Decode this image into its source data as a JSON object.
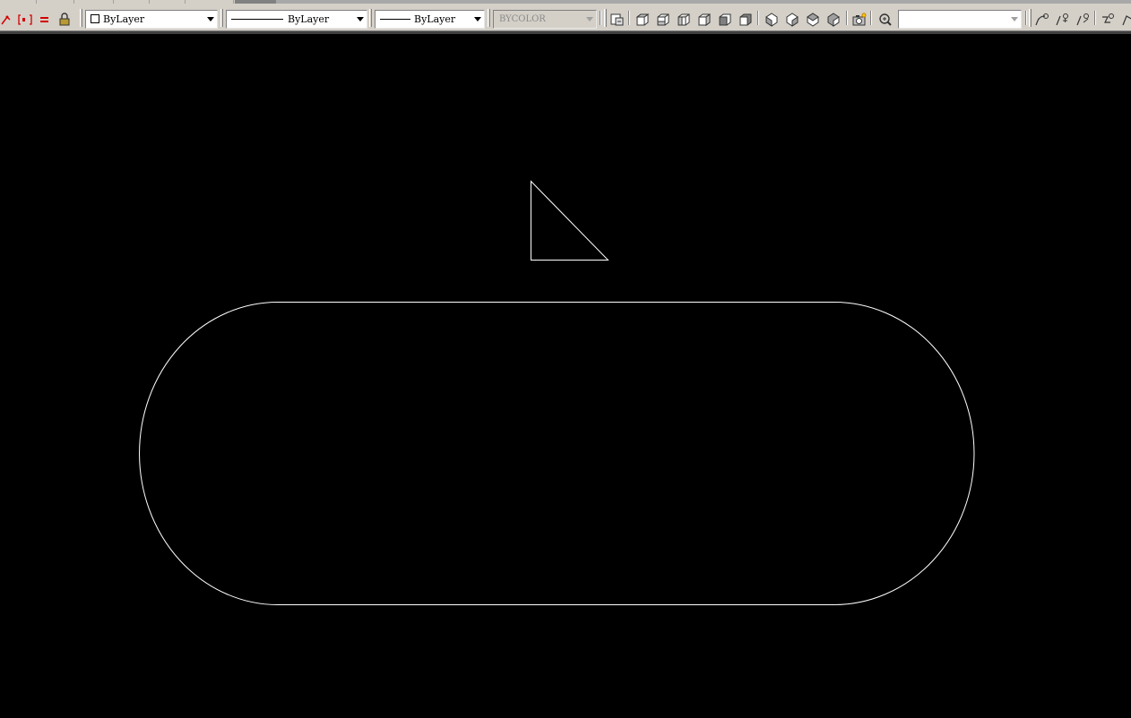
{
  "toolbar": {
    "layer_combo": {
      "value": "ByLayer"
    },
    "color_combo": {
      "value": "ByLayer"
    },
    "linetype_combo": {
      "value": "ByLayer"
    },
    "lineweight_combo": {
      "value": "BYCOLOR"
    },
    "named_view_combo": {
      "value": ""
    }
  },
  "icons": [
    "match-layer-icon",
    "layer-isolate-icon",
    "layer-equal-icon",
    "lock-icon",
    "named-views-icon",
    "top-view-icon",
    "bottom-view-icon",
    "left-view-icon",
    "right-view-icon",
    "front-view-icon",
    "back-view-icon",
    "sw-iso-view-icon",
    "se-iso-view-icon",
    "ne-iso-view-icon",
    "nw-iso-view-icon",
    "camera-icon",
    "ucs-icon",
    "ucs-origin-icon",
    "ucs-x-icon",
    "ucs-y-icon",
    "ucs-z-icon"
  ],
  "colors": {
    "toolbar_bg": "#d4d0c8",
    "canvas_bg": "#000000",
    "drawing_stroke": "#ffffff",
    "icon_accent_red": "#d40000"
  },
  "drawing": {
    "entities": [
      "triangle",
      "slot"
    ]
  }
}
